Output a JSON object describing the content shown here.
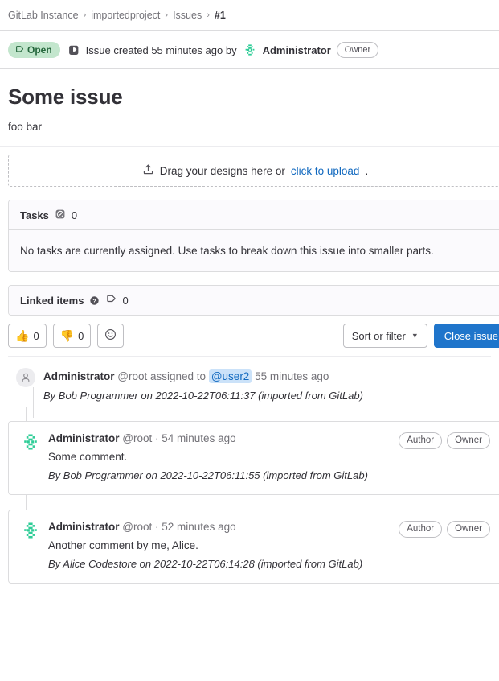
{
  "breadcrumb": {
    "separator": "›",
    "items": [
      {
        "label": "GitLab Instance",
        "current": false
      },
      {
        "label": "importedproject",
        "current": false
      },
      {
        "label": "Issues",
        "current": false
      },
      {
        "label": "#1",
        "current": true
      }
    ]
  },
  "status": {
    "state_label": "Open",
    "state_icon": "issue-open-icon",
    "issue_icon": "issue-type-icon",
    "created_text": "Issue created 55 minutes ago by",
    "author": "Administrator",
    "author_avatar": "identicon-avatar",
    "role_badge": "Owner"
  },
  "issue": {
    "title": "Some issue",
    "description": "foo bar"
  },
  "designs": {
    "upload_icon": "upload-icon",
    "text_before": "Drag your designs here or",
    "link_label": "click to upload",
    "text_after": "."
  },
  "tasks": {
    "title": "Tasks",
    "icon": "task-done-icon",
    "count": "0",
    "empty_text": "No tasks are currently assigned. Use tasks to break down this issue into smaller parts."
  },
  "linked_items": {
    "title": "Linked items",
    "help_icon": "question-circle-icon",
    "icon": "issue-type-icon",
    "count": "0"
  },
  "activity_toolbar": {
    "thumbsup": {
      "emoji": "👍",
      "count": "0",
      "icon": "thumbs-up-icon"
    },
    "thumbsdown": {
      "emoji": "👎",
      "count": "0",
      "icon": "thumbs-down-icon"
    },
    "add_reaction_icon": "smiley-face-icon",
    "sort_label": "Sort or filter",
    "sort_chevron": "chevron-down-icon",
    "primary_button": "Close issue"
  },
  "activity": {
    "system_note": {
      "avatar_icon": "user-icon",
      "actor": "Administrator",
      "actor_handle": "@root",
      "action": "assigned to",
      "assignee": "@user2",
      "timestamp": "55 minutes ago",
      "imported_note": "By Bob Programmer on 2022-10-22T06:11:37 (imported from GitLab)"
    },
    "comments": [
      {
        "avatar": "identicon-avatar",
        "author": "Administrator",
        "handle": "@root",
        "separator": "·",
        "timestamp": "54 minutes ago",
        "badges": [
          "Author",
          "Owner"
        ],
        "body": "Some comment.",
        "imported_note": "By Bob Programmer on 2022-10-22T06:11:55 (imported from GitLab)"
      },
      {
        "avatar": "identicon-avatar",
        "author": "Administrator",
        "handle": "@root",
        "separator": "·",
        "timestamp": "52 minutes ago",
        "badges": [
          "Author",
          "Owner"
        ],
        "body": "Another comment by me, Alice.",
        "imported_note": "By Alice Codestore on 2022-10-22T06:14:28 (imported from GitLab)"
      }
    ]
  },
  "colors": {
    "open_badge_bg": "#c3e6cd",
    "open_badge_text": "#24663b",
    "link": "#1068bf",
    "primary_button": "#1f75cb",
    "mention_bg": "#cbe2f9",
    "border": "#dcdcde",
    "panel_bg": "#fbfafd",
    "avatar_green": "#2ecd97"
  }
}
